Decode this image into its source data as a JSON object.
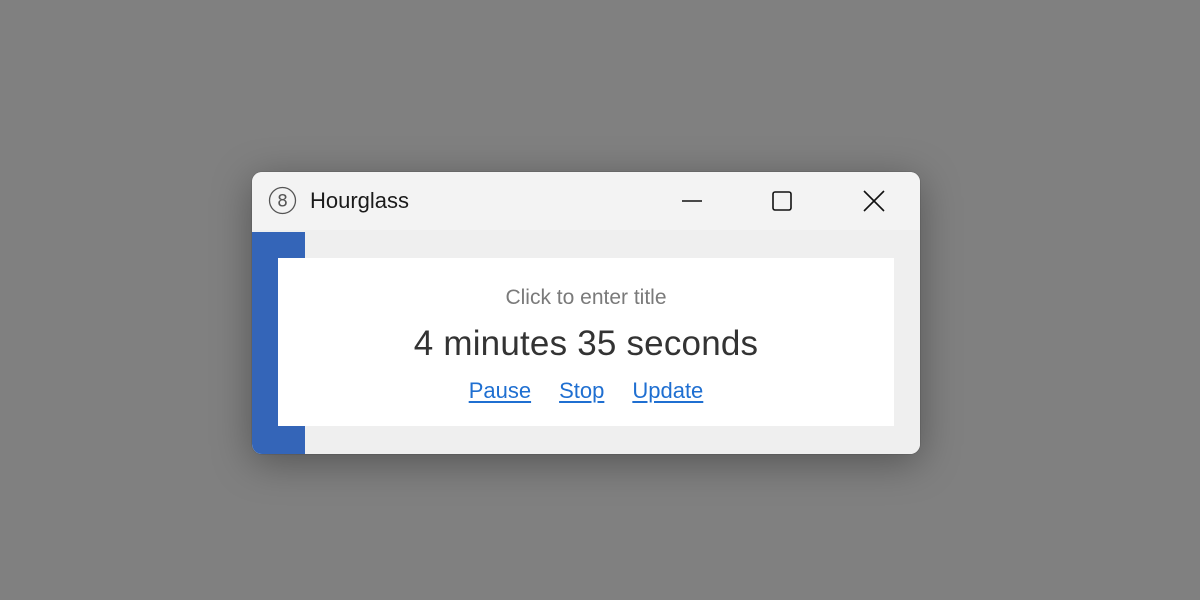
{
  "window": {
    "title": "Hourglass",
    "icon": "hourglass-8-icon",
    "controls": {
      "minimize": "minimize-icon",
      "maximize": "maximize-icon",
      "close": "close-icon"
    }
  },
  "timer": {
    "title_placeholder": "Click to enter title",
    "time_remaining": "4 minutes 35 seconds",
    "progress_fraction": 0.08
  },
  "actions": {
    "pause": "Pause",
    "stop": "Stop",
    "update": "Update"
  },
  "colors": {
    "progress": "#3465b8",
    "link": "#1f6fd1",
    "desktop": "#808080"
  }
}
